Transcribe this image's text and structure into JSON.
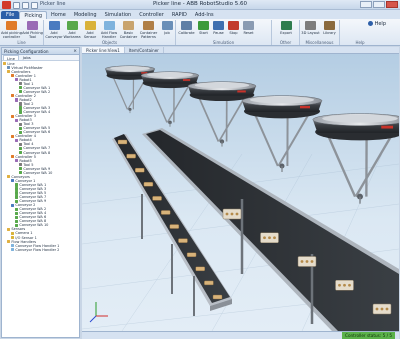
{
  "window": {
    "title": "Picker line - ABB RobotStudio 5.60",
    "document_name": "Picker line"
  },
  "tabs": [
    {
      "label": "File"
    },
    {
      "label": "Picking"
    },
    {
      "label": "Home"
    },
    {
      "label": "Modeling"
    },
    {
      "label": "Simulation"
    },
    {
      "label": "Controller"
    },
    {
      "label": "RAPID"
    },
    {
      "label": "Add-Ins"
    }
  ],
  "ribbon": {
    "buttons": [
      {
        "label": "Add picking controller",
        "color": "#e07b2a"
      },
      {
        "label": "Add Picking Tool",
        "color": "#9a6bb5"
      },
      {
        "label": "Add Conveyor",
        "color": "#4a7bc0"
      },
      {
        "label": "Add Workarea",
        "color": "#58a84b"
      },
      {
        "label": "Add Sensor",
        "color": "#d9b23a"
      },
      {
        "label": "Add Flow Handler",
        "color": "#7fb3dd"
      },
      {
        "label": "Basic Container",
        "color": "#c9a46e"
      },
      {
        "label": "Container Patterns",
        "color": "#b07f47"
      },
      {
        "label": "Job",
        "color": "#6a8fb8"
      },
      {
        "label": "Calibrate",
        "color": "#5f7fa6"
      },
      {
        "label": "Start",
        "color": "#3b9a3b"
      },
      {
        "label": "Pause",
        "color": "#3e6fb0"
      },
      {
        "label": "Stop",
        "color": "#c23a2c"
      },
      {
        "label": "Reset",
        "color": "#8a9bb2"
      },
      {
        "label": "Export",
        "color": "#2f7d4f"
      },
      {
        "label": "3D Layout",
        "color": "#7d7d7d"
      },
      {
        "label": "Library",
        "color": "#8a6a3e"
      }
    ],
    "groups": [
      "Line",
      "Objects",
      "Simulation",
      "Other",
      "Miscellaneous",
      "Help"
    ],
    "help_label": "Help"
  },
  "panel": {
    "title": "Picking Configuration",
    "tabs": [
      "Line",
      "Jobs"
    ],
    "tree": [
      {
        "label": "Line",
        "indent": 0,
        "icon": "folder-icon",
        "color": "#e0b040"
      },
      {
        "label": "Virtual PickMaster",
        "indent": 1,
        "icon": "computer-icon",
        "color": "#6a8fb8"
      },
      {
        "label": "Controllers",
        "indent": 1,
        "icon": "folder-icon",
        "color": "#e0b040"
      },
      {
        "label": "Controller 1",
        "indent": 2,
        "icon": "controller-icon",
        "color": "#e07b2a"
      },
      {
        "label": "Robot1",
        "indent": 3,
        "icon": "robot-icon",
        "color": "#9a6bb5"
      },
      {
        "label": "Tool 1",
        "indent": 4,
        "icon": "tool-icon",
        "color": "#7d7d7d"
      },
      {
        "label": "Conveyor WA 1",
        "indent": 4,
        "icon": "workarea-icon",
        "color": "#58a84b"
      },
      {
        "label": "Conveyor WA 2",
        "indent": 4,
        "icon": "workarea-icon",
        "color": "#58a84b"
      },
      {
        "label": "Controller 2",
        "indent": 2,
        "icon": "controller-icon",
        "color": "#e07b2a"
      },
      {
        "label": "Robot2",
        "indent": 3,
        "icon": "robot-icon",
        "color": "#9a6bb5"
      },
      {
        "label": "Tool 2",
        "indent": 4,
        "icon": "tool-icon",
        "color": "#7d7d7d"
      },
      {
        "label": "Conveyor WA 3",
        "indent": 4,
        "icon": "workarea-icon",
        "color": "#58a84b"
      },
      {
        "label": "Conveyor WA 4",
        "indent": 4,
        "icon": "workarea-icon",
        "color": "#58a84b"
      },
      {
        "label": "Controller 3",
        "indent": 2,
        "icon": "controller-icon",
        "color": "#e07b2a"
      },
      {
        "label": "Robot3",
        "indent": 3,
        "icon": "robot-icon",
        "color": "#9a6bb5"
      },
      {
        "label": "Tool 3",
        "indent": 4,
        "icon": "tool-icon",
        "color": "#7d7d7d"
      },
      {
        "label": "Conveyor WA 5",
        "indent": 4,
        "icon": "workarea-icon",
        "color": "#58a84b"
      },
      {
        "label": "Conveyor WA 6",
        "indent": 4,
        "icon": "workarea-icon",
        "color": "#58a84b"
      },
      {
        "label": "Controller 4",
        "indent": 2,
        "icon": "controller-icon",
        "color": "#e07b2a"
      },
      {
        "label": "Robot4",
        "indent": 3,
        "icon": "robot-icon",
        "color": "#9a6bb5"
      },
      {
        "label": "Tool 4",
        "indent": 4,
        "icon": "tool-icon",
        "color": "#7d7d7d"
      },
      {
        "label": "Conveyor WA 7",
        "indent": 4,
        "icon": "workarea-icon",
        "color": "#58a84b"
      },
      {
        "label": "Conveyor WA 8",
        "indent": 4,
        "icon": "workarea-icon",
        "color": "#58a84b"
      },
      {
        "label": "Controller 5",
        "indent": 2,
        "icon": "controller-icon",
        "color": "#e07b2a"
      },
      {
        "label": "Robot5",
        "indent": 3,
        "icon": "robot-icon",
        "color": "#9a6bb5"
      },
      {
        "label": "Tool 5",
        "indent": 4,
        "icon": "tool-icon",
        "color": "#7d7d7d"
      },
      {
        "label": "Conveyor WA 9",
        "indent": 4,
        "icon": "workarea-icon",
        "color": "#58a84b"
      },
      {
        "label": "Conveyor WA 10",
        "indent": 4,
        "icon": "workarea-icon",
        "color": "#58a84b"
      },
      {
        "label": "Conveyors",
        "indent": 1,
        "icon": "folder-icon",
        "color": "#e0b040"
      },
      {
        "label": "Conveyor 1",
        "indent": 2,
        "icon": "conveyor-icon",
        "color": "#4a7bc0"
      },
      {
        "label": "Conveyor WA 1",
        "indent": 3,
        "icon": "workarea-icon",
        "color": "#58a84b"
      },
      {
        "label": "Conveyor WA 3",
        "indent": 3,
        "icon": "workarea-icon",
        "color": "#58a84b"
      },
      {
        "label": "Conveyor WA 5",
        "indent": 3,
        "icon": "workarea-icon",
        "color": "#58a84b"
      },
      {
        "label": "Conveyor WA 7",
        "indent": 3,
        "icon": "workarea-icon",
        "color": "#58a84b"
      },
      {
        "label": "Conveyor WA 9",
        "indent": 3,
        "icon": "workarea-icon",
        "color": "#58a84b"
      },
      {
        "label": "Conveyor 2",
        "indent": 2,
        "icon": "conveyor-icon",
        "color": "#4a7bc0"
      },
      {
        "label": "Conveyor WA 2",
        "indent": 3,
        "icon": "workarea-icon",
        "color": "#58a84b"
      },
      {
        "label": "Conveyor WA 4",
        "indent": 3,
        "icon": "workarea-icon",
        "color": "#58a84b"
      },
      {
        "label": "Conveyor WA 6",
        "indent": 3,
        "icon": "workarea-icon",
        "color": "#58a84b"
      },
      {
        "label": "Conveyor WA 8",
        "indent": 3,
        "icon": "workarea-icon",
        "color": "#58a84b"
      },
      {
        "label": "Conveyor WA 10",
        "indent": 3,
        "icon": "workarea-icon",
        "color": "#58a84b"
      },
      {
        "label": "Sensors",
        "indent": 1,
        "icon": "folder-icon",
        "color": "#e0b040"
      },
      {
        "label": "Camera 1",
        "indent": 2,
        "icon": "camera-icon",
        "color": "#d9b23a"
      },
      {
        "label": "I/O Sensor 1",
        "indent": 2,
        "icon": "sensor-icon",
        "color": "#d9b23a"
      },
      {
        "label": "Flow Handlers",
        "indent": 1,
        "icon": "folder-icon",
        "color": "#e0b040"
      },
      {
        "label": "Conveyor Flow Handler 1",
        "indent": 2,
        "icon": "flow-handler-icon",
        "color": "#7fb3dd"
      },
      {
        "label": "Conveyor Flow Handler 2",
        "indent": 2,
        "icon": "flow-handler-icon",
        "color": "#7fb3dd"
      }
    ]
  },
  "view_tabs": [
    "Picker line:View1",
    "Item/Container"
  ],
  "status": {
    "controller_status": "Controller status: 5 / 5"
  },
  "colors": {
    "accent": "#2d5fa8",
    "robot_body": "#3b3f44",
    "conveyor_belt": "#2e3236",
    "status_ok": "#5bb24a"
  }
}
